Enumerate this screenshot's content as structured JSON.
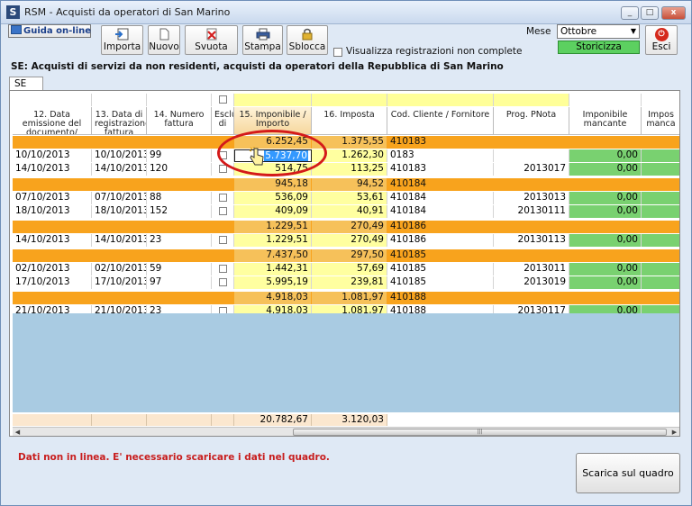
{
  "window": {
    "title": "RSM - Acquisti da operatori di San Marino",
    "min_label": "_",
    "max_label": "□",
    "close_label": "x"
  },
  "toolbar": {
    "guida_label": "Guida on-line",
    "importa_label": "Importa",
    "nuovo_label": "Nuovo",
    "svuota_label": "Svuota",
    "stampa_label": "Stampa",
    "sblocca_label": "Sblocca",
    "visualizza_label": "Visualizza registrazioni non complete",
    "mese_label": "Mese",
    "mese_value": "Ottobre",
    "storicizza_label": "Storicizza",
    "esci_label": "Esci"
  },
  "section_title": "SE: Acquisti di servizi da non residenti, acquisti da operatori della Repubblica di San Marino",
  "tab_label": "SE",
  "columns": [
    "12. Data emissione del documento/ fattura",
    "13. Data di registrazione fattura",
    "14. Numero fattura",
    "Esclu di",
    "15. Imponibile / Importo",
    "16. Imposta",
    "Cod. Cliente / Fornitore",
    "Prog. PNota",
    "Imponibile mancante",
    "Impos manca"
  ],
  "rows": [
    {
      "type": "grp",
      "imponibile": "6.252,45",
      "imposta": "1.375,55",
      "cod": "410183"
    },
    {
      "type": "det",
      "data_em": "10/10/2013",
      "data_reg": "10/10/2013",
      "num": "99",
      "imponibile": "5.737,70",
      "imposta": "1.262,30",
      "cod": "0183",
      "pnota": "",
      "mancante": "0,00",
      "active": true
    },
    {
      "type": "det",
      "data_em": "14/10/2013",
      "data_reg": "14/10/2013",
      "num": "120",
      "imponibile": "514,75",
      "imposta": "113,25",
      "cod": "410183",
      "pnota": "2013017",
      "mancante": "0,00"
    },
    {
      "type": "grp",
      "imponibile": "945,18",
      "imposta": "94,52",
      "cod": "410184"
    },
    {
      "type": "det",
      "data_em": "07/10/2013",
      "data_reg": "07/10/2013",
      "num": "88",
      "imponibile": "536,09",
      "imposta": "53,61",
      "cod": "410184",
      "pnota": "2013013",
      "mancante": "0,00"
    },
    {
      "type": "det",
      "data_em": "18/10/2013",
      "data_reg": "18/10/2013",
      "num": "152",
      "imponibile": "409,09",
      "imposta": "40,91",
      "cod": "410184",
      "pnota": "20130111",
      "mancante": "0,00"
    },
    {
      "type": "grp",
      "imponibile": "1.229,51",
      "imposta": "270,49",
      "cod": "410186"
    },
    {
      "type": "det",
      "data_em": "14/10/2013",
      "data_reg": "14/10/2013",
      "num": "23",
      "imponibile": "1.229,51",
      "imposta": "270,49",
      "cod": "410186",
      "pnota": "20130113",
      "mancante": "0,00"
    },
    {
      "type": "grp",
      "imponibile": "7.437,50",
      "imposta": "297,50",
      "cod": "410185"
    },
    {
      "type": "det",
      "data_em": "02/10/2013",
      "data_reg": "02/10/2013",
      "num": "59",
      "imponibile": "1.442,31",
      "imposta": "57,69",
      "cod": "410185",
      "pnota": "2013011",
      "mancante": "0,00"
    },
    {
      "type": "det",
      "data_em": "17/10/2013",
      "data_reg": "17/10/2013",
      "num": "97",
      "imponibile": "5.995,19",
      "imposta": "239,81",
      "cod": "410185",
      "pnota": "2013019",
      "mancante": "0,00"
    },
    {
      "type": "grp",
      "imponibile": "4.918,03",
      "imposta": "1.081,97",
      "cod": "410188"
    },
    {
      "type": "det",
      "data_em": "21/10/2013",
      "data_reg": "21/10/2013",
      "num": "23",
      "imponibile": "4.918,03",
      "imposta": "1.081,97",
      "cod": "410188",
      "pnota": "20130117",
      "mancante": "0,00"
    }
  ],
  "totals": {
    "imponibile": "20.782,67",
    "imposta": "3.120,03"
  },
  "scroll_grip": "|||",
  "status_message": "Dati non in linea. E' necessario scaricare i dati nel quadro.",
  "scarica_label": "Scarica sul quadro"
}
